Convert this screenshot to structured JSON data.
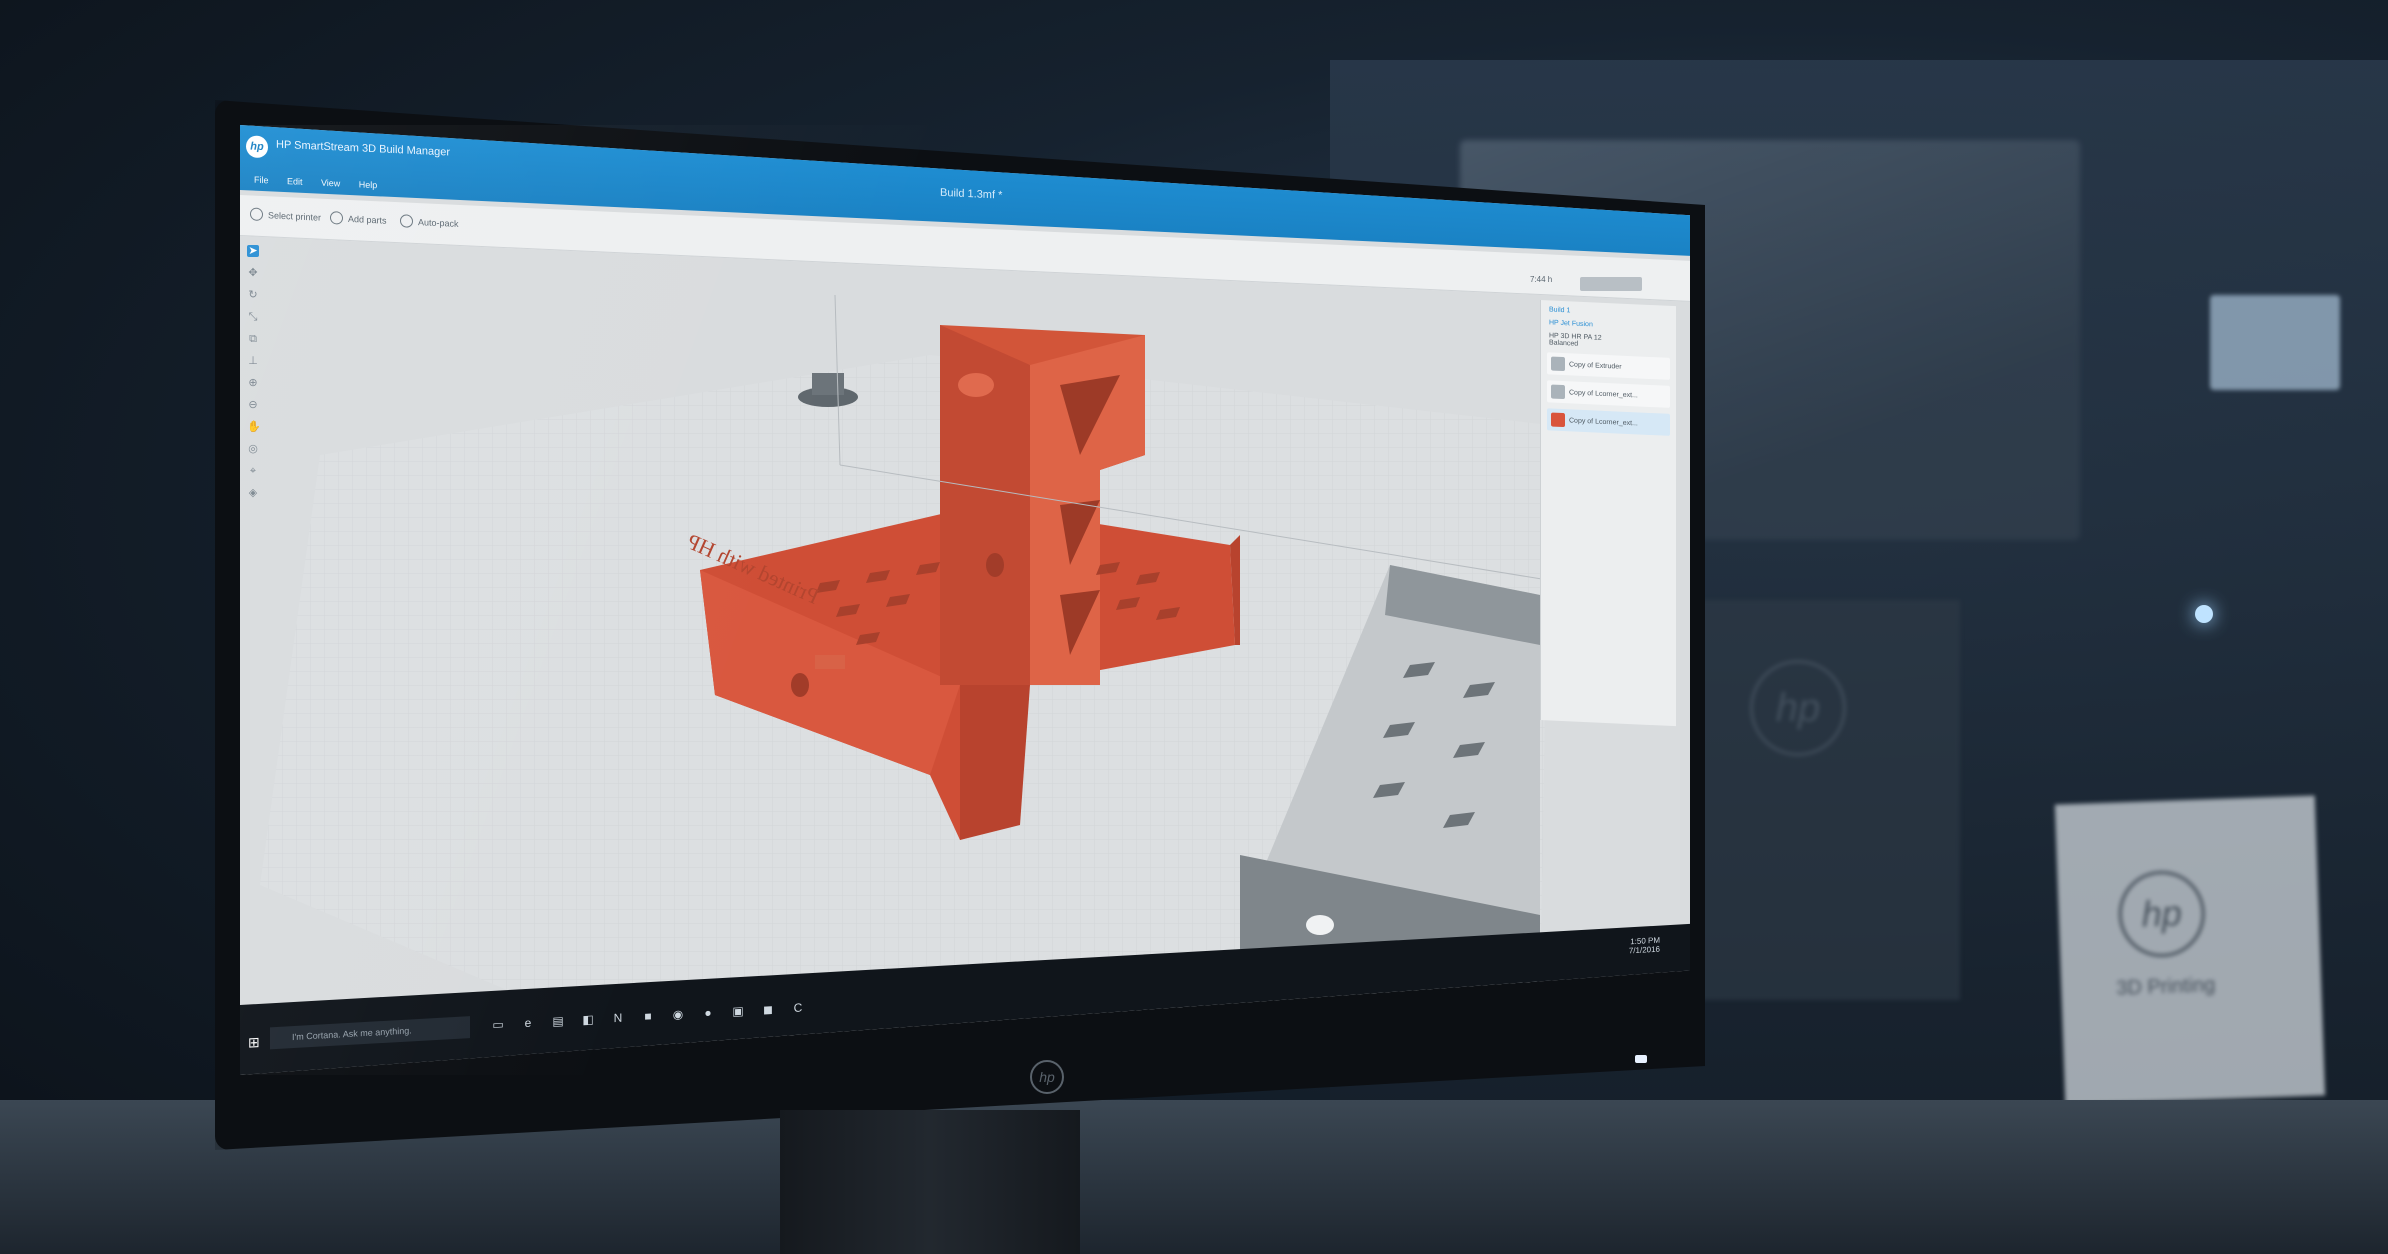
{
  "app": {
    "title": "HP SmartStream 3D Build Manager",
    "document_title": "Build 1.3mf *",
    "logo": "hp",
    "window_controls": [
      "—",
      "□",
      "✕"
    ]
  },
  "menu": [
    "File",
    "Edit",
    "View",
    "Help"
  ],
  "toolbar": [
    {
      "label": "Select printer",
      "icon": "printer-icon"
    },
    {
      "label": "Add parts",
      "icon": "add-parts-icon"
    },
    {
      "label": "Auto-pack",
      "icon": "auto-pack-icon"
    }
  ],
  "left_tools": [
    {
      "icon": "select-arrow-icon",
      "glyph": "➤",
      "active": true
    },
    {
      "icon": "move-icon",
      "glyph": "✥"
    },
    {
      "icon": "rotate-icon",
      "glyph": "↻"
    },
    {
      "icon": "scale-icon",
      "glyph": "⤡"
    },
    {
      "icon": "duplicate-icon",
      "glyph": "⧉"
    },
    {
      "icon": "align-icon",
      "glyph": "⊥"
    },
    {
      "icon": "zoom-in-icon",
      "glyph": "⊕"
    },
    {
      "icon": "zoom-out-icon",
      "glyph": "⊖"
    },
    {
      "icon": "pan-hand-icon",
      "glyph": "✋"
    },
    {
      "icon": "orbit-icon",
      "glyph": "◎"
    },
    {
      "icon": "fit-view-icon",
      "glyph": "⌖"
    },
    {
      "icon": "view-cube-icon",
      "glyph": "◈"
    }
  ],
  "right_panel": {
    "time": "7:44 h",
    "build_label": "Build 1",
    "printer_label": "HP Jet Fusion",
    "material": "HP 3D HR PA 12",
    "quality": "Balanced",
    "parts": [
      {
        "name": "Copy of Extruder",
        "thumb": "gray"
      },
      {
        "name": "Copy of Lcorner_ext...",
        "thumb": "gray"
      },
      {
        "name": "Copy of Lcorner_ext...",
        "thumb": "red",
        "selected": true
      }
    ]
  },
  "model_text": "Printed with HP",
  "taskbar": {
    "search_placeholder": "I'm Cortana. Ask me anything.",
    "time": "1:50 PM",
    "date": "7/1/2016"
  },
  "background": {
    "brand": "3D Printing"
  },
  "colors": {
    "accent": "#1a82c4",
    "part": "#d9543c",
    "grid": "#c9cdd0"
  }
}
